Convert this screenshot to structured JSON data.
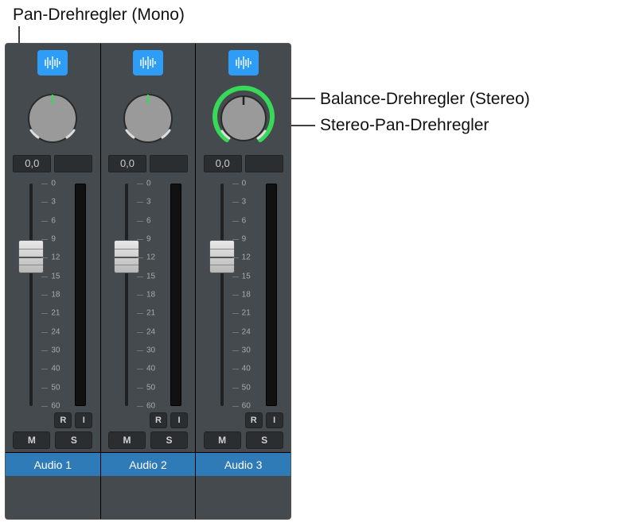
{
  "labels": {
    "top": "Pan-Drehregler (Mono)",
    "right1": "Balance-Drehregler (Stereo)",
    "right2": "Stereo-Pan-Drehregler"
  },
  "colors": {
    "accent": "#2e9df7",
    "panGreen": "#38d858",
    "trackName": "#2e7bb8"
  },
  "scale": [
    "0",
    "3",
    "6",
    "9",
    "12",
    "15",
    "18",
    "21",
    "24",
    "30",
    "40",
    "50",
    "60"
  ],
  "strips": [
    {
      "icon": "waveform-mono-icon",
      "knob": "mono",
      "value": "0,0",
      "r": "R",
      "i": "I",
      "m": "M",
      "s": "S",
      "name": "Audio 1",
      "faderPos": 71
    },
    {
      "icon": "waveform-mono-icon",
      "knob": "mono",
      "value": "0,0",
      "r": "R",
      "i": "I",
      "m": "M",
      "s": "S",
      "name": "Audio 2",
      "faderPos": 71
    },
    {
      "icon": "waveform-stereo-icon",
      "knob": "stereo",
      "value": "0,0",
      "r": "R",
      "i": "I",
      "m": "M",
      "s": "S",
      "name": "Audio 3",
      "faderPos": 71
    }
  ]
}
